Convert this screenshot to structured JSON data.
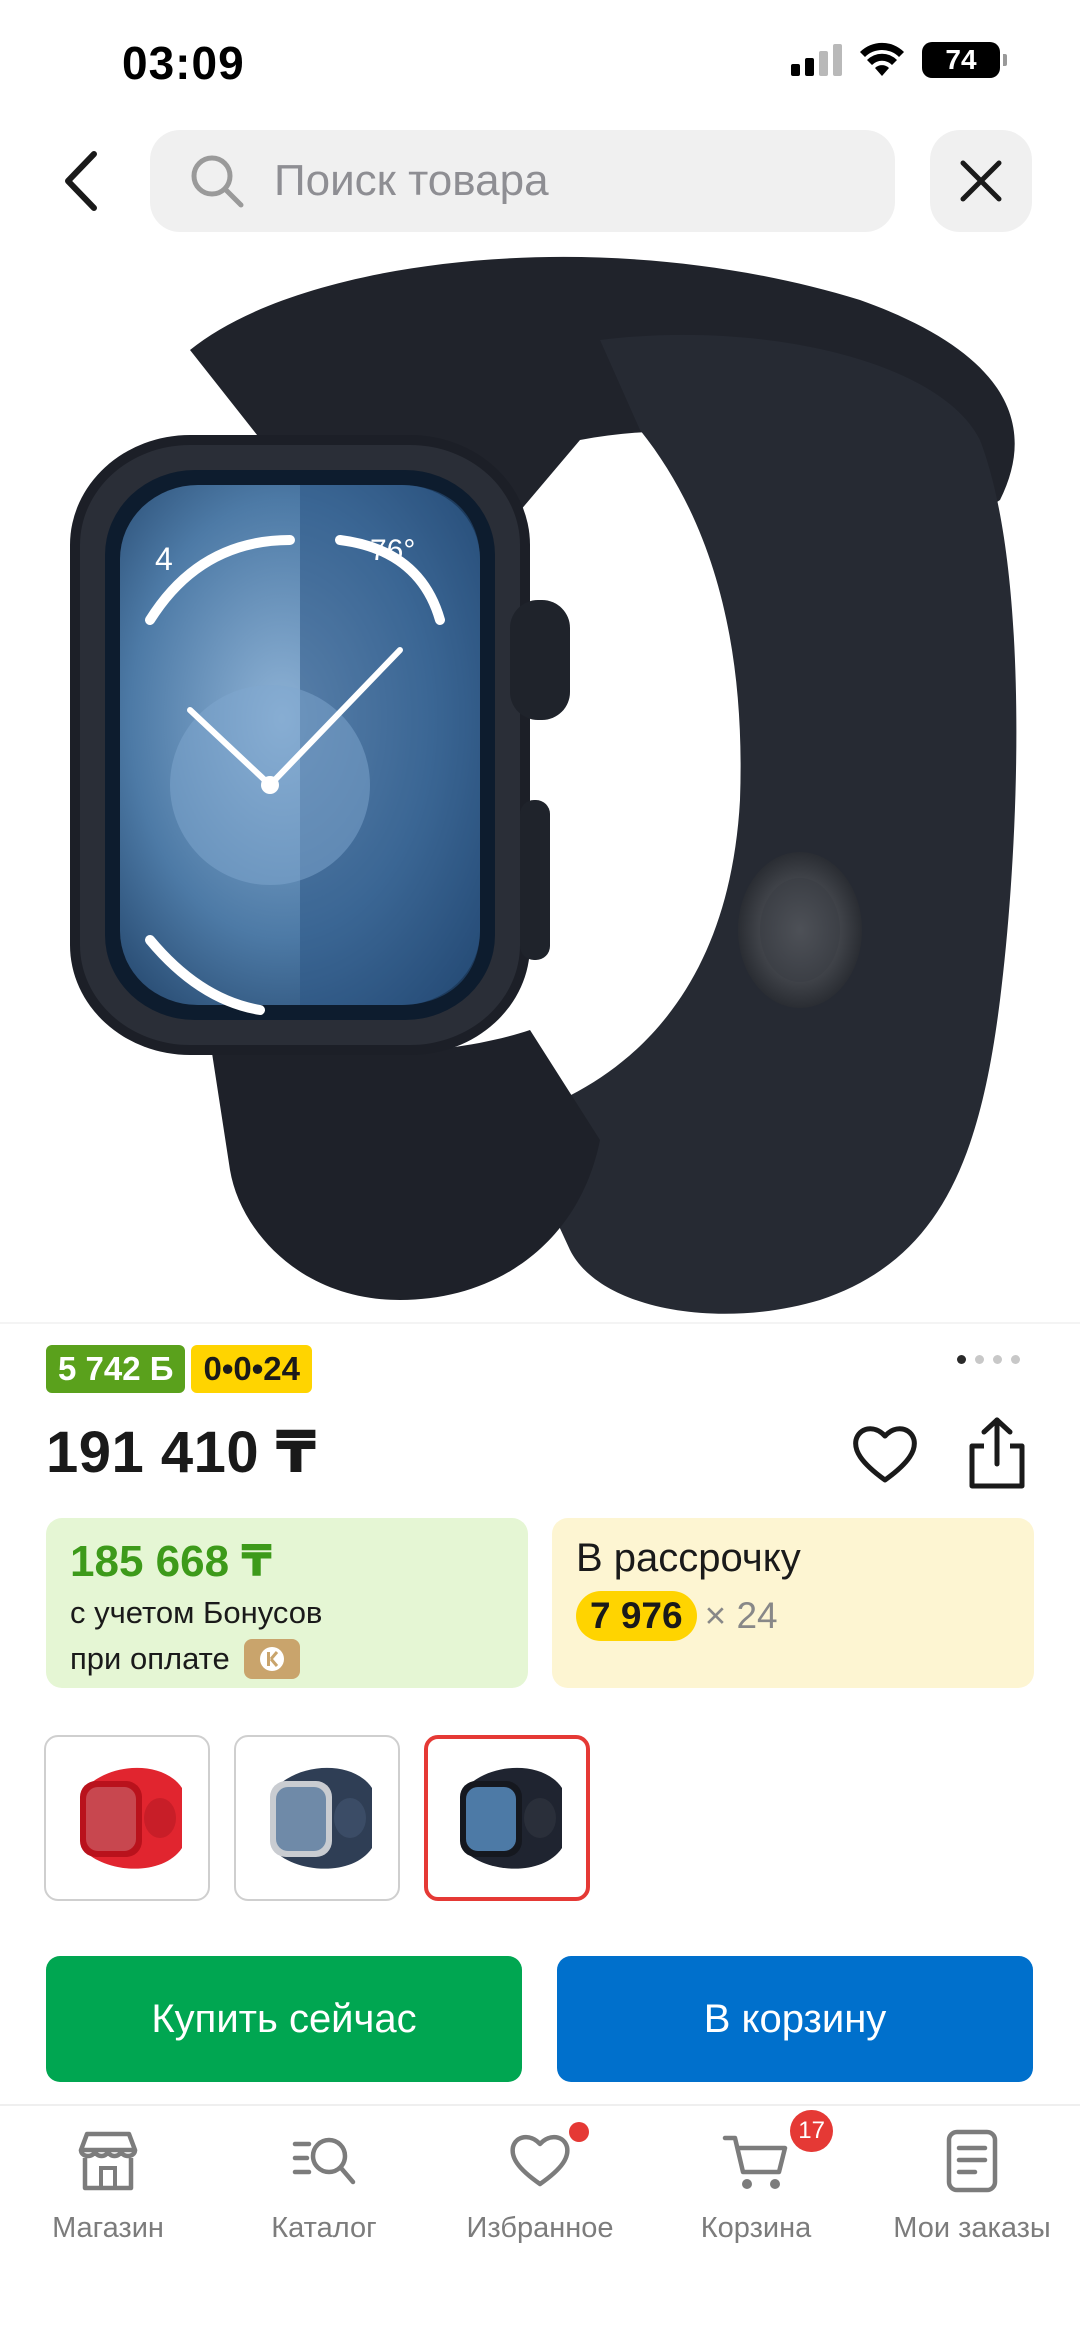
{
  "status_bar": {
    "time": "03:09",
    "battery": "74",
    "icons": [
      "cellular-signal-icon",
      "wifi-icon",
      "battery-icon"
    ]
  },
  "header": {
    "search_placeholder": "Поиск товара",
    "icons": [
      "chevron-left-icon",
      "search-icon",
      "close-icon"
    ]
  },
  "product": {
    "image_icon": "apple-watch-midnight-image",
    "bonus_badge": "5 742 Б",
    "installment_badge": "0•0•24",
    "gallery_pages": 4,
    "gallery_active_page": 1,
    "price": "191 410 ₸",
    "bonus_card": {
      "amount": "185 668 ₸",
      "line1": "с учетом Бонусов",
      "line2": "при оплате"
    },
    "installment_card": {
      "title": "В рассрочку",
      "monthly": "7 976",
      "months": "× 24"
    },
    "variants": [
      {
        "color": "red",
        "hex": "#e1252f",
        "selected": false
      },
      {
        "color": "silver-storm-blue",
        "hex": "#2f3e55",
        "selected": false
      },
      {
        "color": "midnight",
        "hex": "#1f2430",
        "selected": true
      }
    ]
  },
  "actions": {
    "buy_now": "Купить сейчас",
    "add_to_cart": "В корзину"
  },
  "bottom_nav": {
    "items": [
      {
        "label": "Магазин",
        "icon": "store-icon"
      },
      {
        "label": "Каталог",
        "icon": "catalog-search-icon"
      },
      {
        "label": "Избранное",
        "icon": "heart-icon",
        "dot": true
      },
      {
        "label": "Корзина",
        "icon": "cart-icon",
        "badge": "17"
      },
      {
        "label": "Мои заказы",
        "icon": "orders-icon"
      }
    ]
  },
  "colors": {
    "green_accent": "#00a651",
    "blue_accent": "#0070cc",
    "bonus_green": "#5aa11c",
    "yellow": "#ffd400",
    "red_badge": "#e53935"
  }
}
